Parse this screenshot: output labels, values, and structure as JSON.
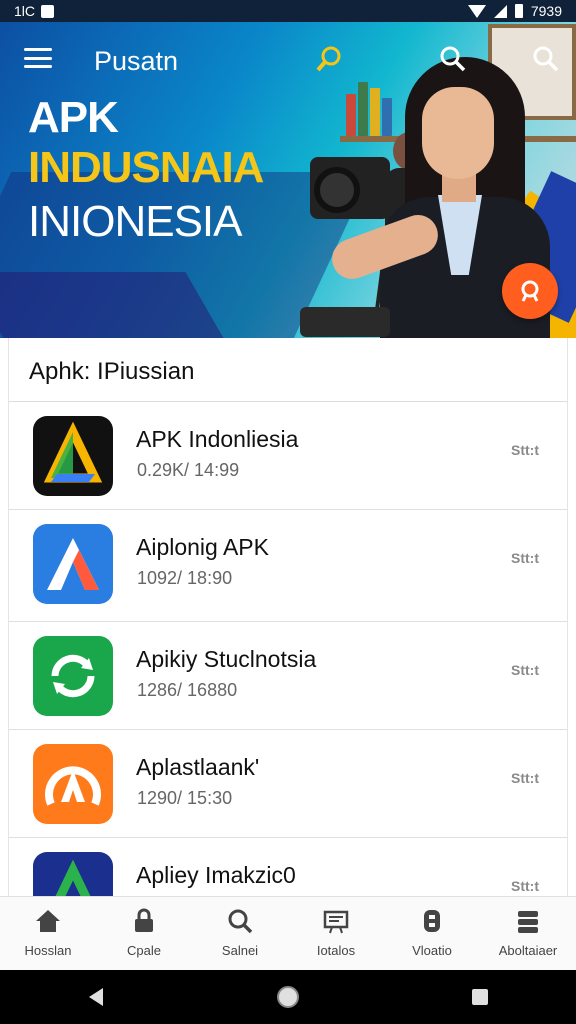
{
  "status_bar": {
    "left_text": "1lC",
    "time": "7939"
  },
  "header": {
    "title": "Pusatn",
    "icons": [
      "menu-icon",
      "camera-search-icon",
      "search-icon",
      "search-icon"
    ]
  },
  "hero": {
    "line1": "APK",
    "line2": "INDUSNAIA",
    "line3": "INIONESIA",
    "fab_icon": "search-icon"
  },
  "section": {
    "title": "Aphk: IPiussian"
  },
  "apps": [
    {
      "name": "APK Indonliesia",
      "meta": "0.29K/ 14:99",
      "action": "Stt:t",
      "icon": "triangle-logo-icon",
      "color": "#111111"
    },
    {
      "name": "Aiplonig APK",
      "meta": "1092/ 18:90",
      "action": "Stt:t",
      "icon": "a-logo-icon",
      "color": "#2a7de1"
    },
    {
      "name": "Apikiy Stuclnotsia",
      "meta": "1286/ 16880",
      "action": "Stt:t",
      "icon": "refresh-logo-icon",
      "color": "#1aa64a"
    },
    {
      "name": "Aplastlaank'",
      "meta": "1290/ 15:30",
      "action": "Stt:t",
      "icon": "arc-logo-icon",
      "color": "#ff7a1a"
    },
    {
      "name": "Apliey Imakzic0",
      "meta": "",
      "action": "Stt:t",
      "icon": "triangle-logo-icon",
      "color": "#1b2f8f"
    }
  ],
  "bottom_nav": [
    {
      "label": "Hosslan",
      "icon": "home-icon"
    },
    {
      "label": "Cpale",
      "icon": "lock-icon"
    },
    {
      "label": "Salnei",
      "icon": "search-icon"
    },
    {
      "label": "Iotalos",
      "icon": "board-icon"
    },
    {
      "label": "Vloatio",
      "icon": "gamepad-icon"
    },
    {
      "label": "Aboltaiaer",
      "icon": "stack-icon"
    }
  ],
  "system_nav": [
    "back-icon",
    "home-circle-icon",
    "recents-icon"
  ]
}
